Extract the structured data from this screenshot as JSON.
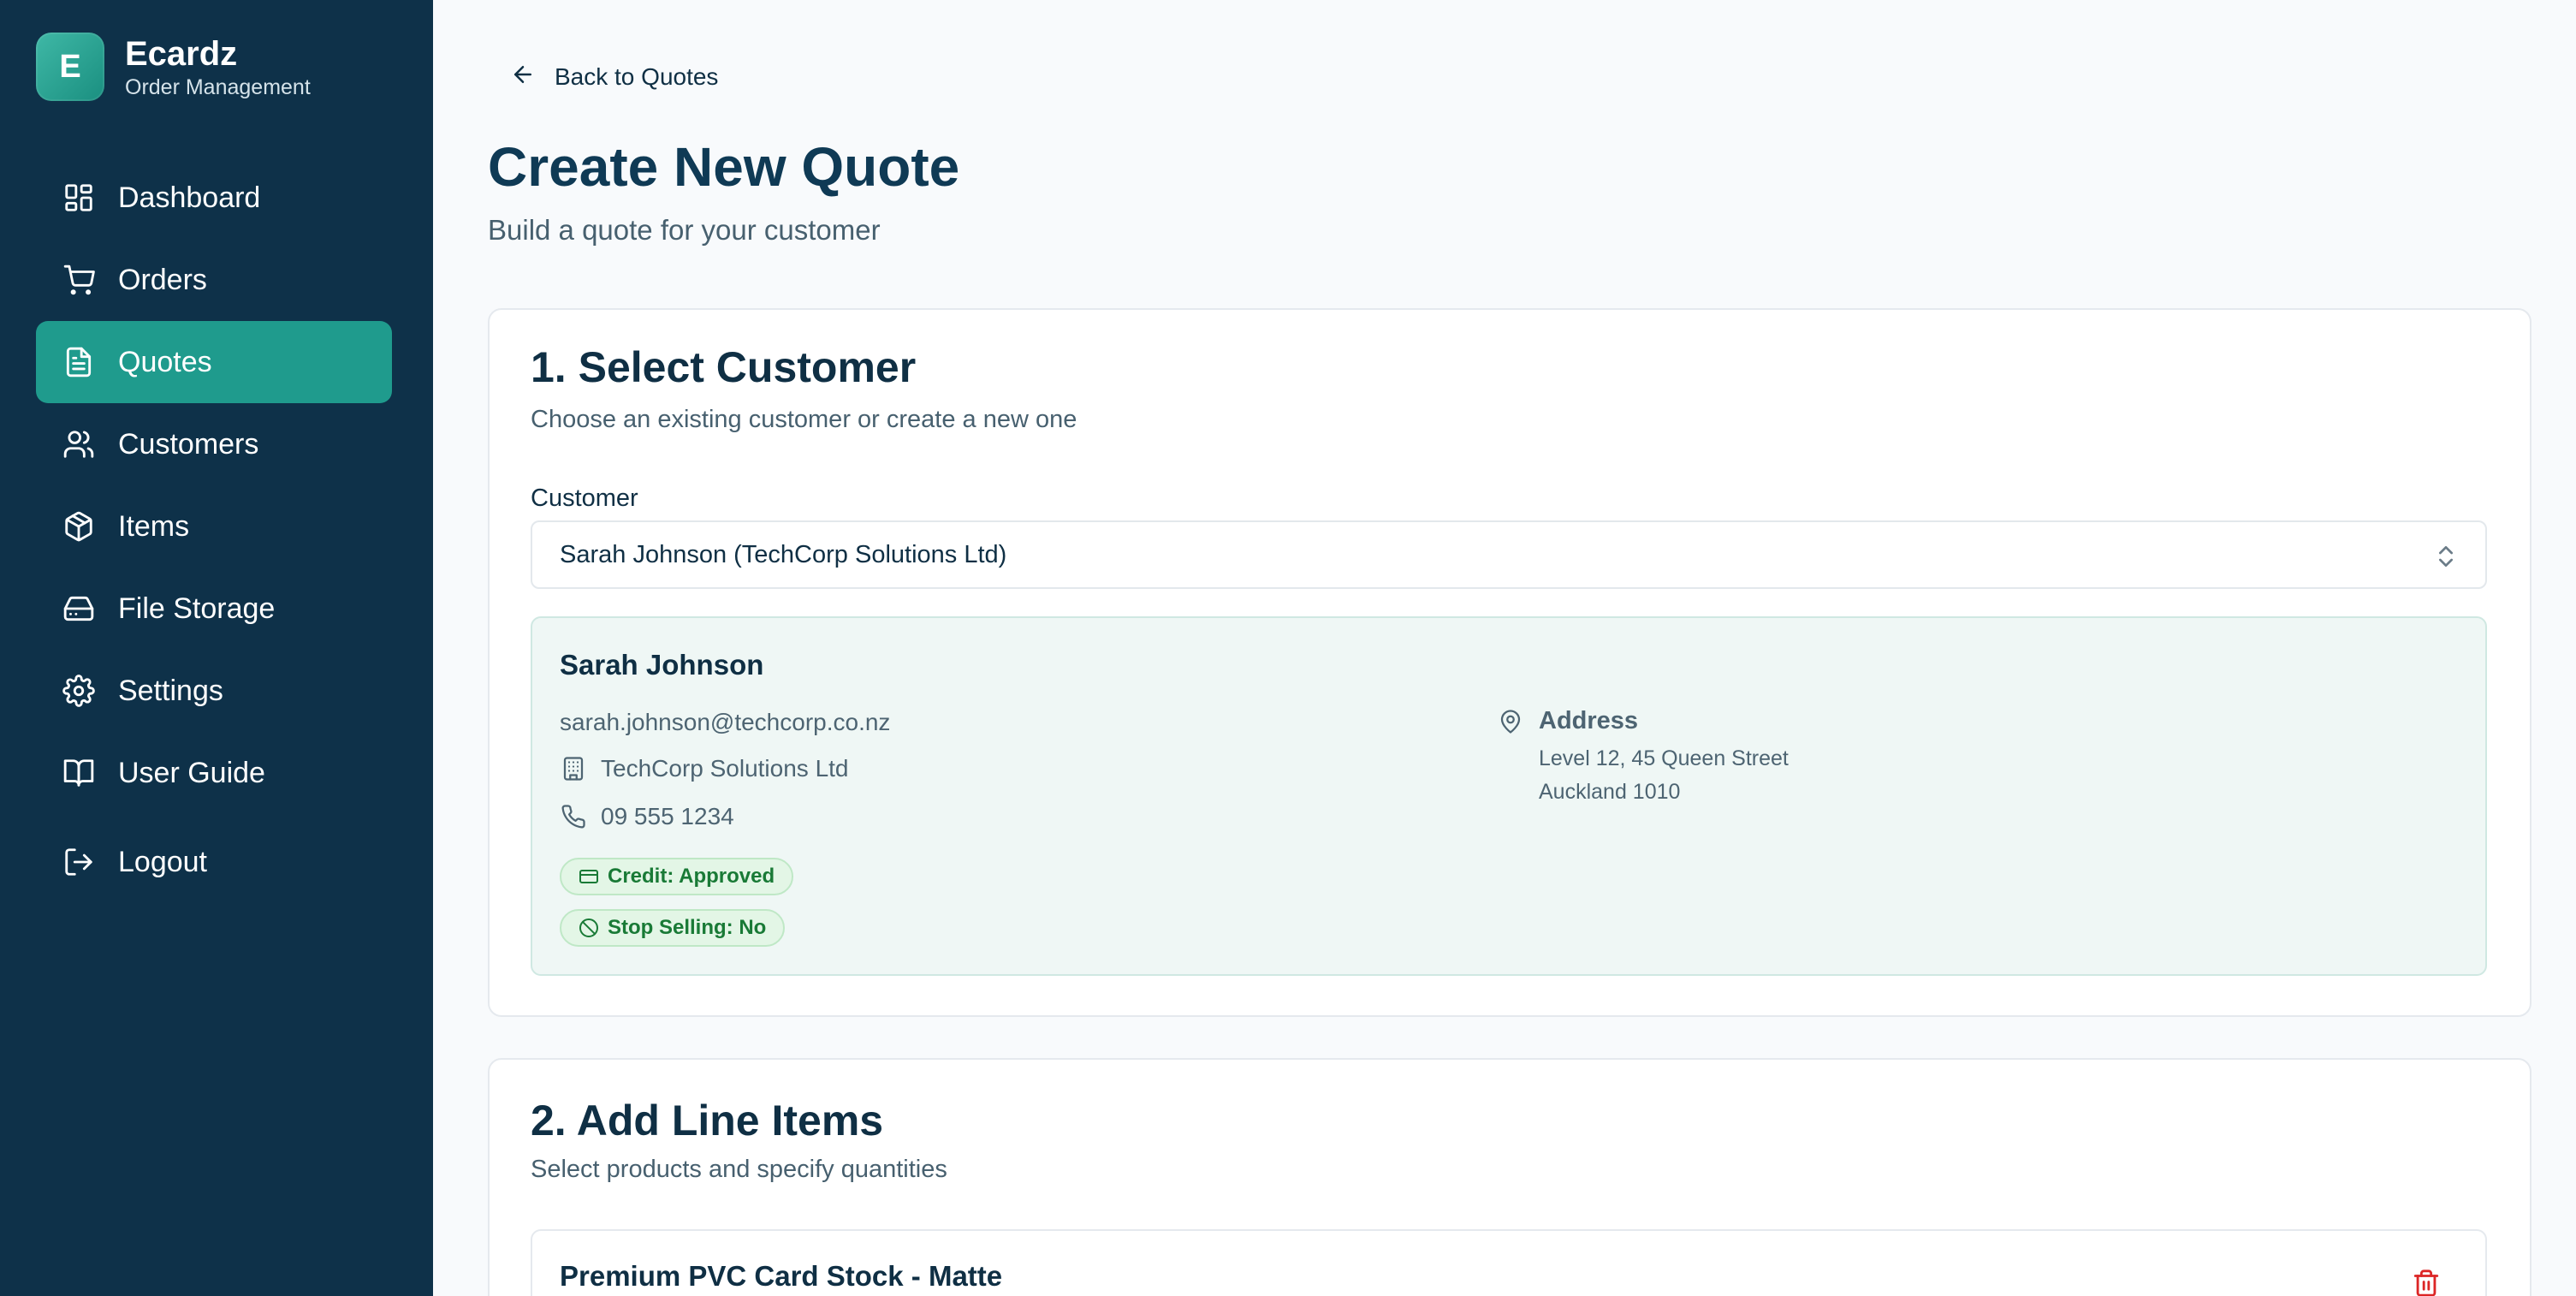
{
  "app": {
    "logo_letter": "E",
    "name": "Ecardz",
    "subtitle": "Order Management"
  },
  "sidebar": {
    "items": [
      {
        "label": "Dashboard",
        "icon": "dashboard-icon"
      },
      {
        "label": "Orders",
        "icon": "cart-icon"
      },
      {
        "label": "Quotes",
        "icon": "document-icon",
        "active": true
      },
      {
        "label": "Customers",
        "icon": "users-icon"
      },
      {
        "label": "Items",
        "icon": "package-icon"
      },
      {
        "label": "File Storage",
        "icon": "hard-drive-icon"
      },
      {
        "label": "Settings",
        "icon": "gear-icon"
      },
      {
        "label": "User Guide",
        "icon": "book-icon"
      },
      {
        "label": "Logout",
        "icon": "logout-icon"
      }
    ]
  },
  "header": {
    "back_label": "Back to Quotes",
    "title": "Create New Quote",
    "subtitle": "Build a quote for your customer"
  },
  "customer_section": {
    "title": "1. Select Customer",
    "subtitle": "Choose an existing customer or create a new one",
    "field_label": "Customer",
    "selected_value": "Sarah Johnson (TechCorp Solutions Ltd)",
    "details": {
      "name": "Sarah Johnson",
      "email": "sarah.johnson@techcorp.co.nz",
      "company": "TechCorp Solutions Ltd",
      "phone": "09 555 1234",
      "credit_badge": "Credit: Approved",
      "stop_selling_badge": "Stop Selling: No",
      "address_label": "Address",
      "address_line1": "Level 12, 45 Queen Street",
      "address_line2": "Auckland 1010"
    }
  },
  "line_items_section": {
    "title": "2. Add Line Items",
    "subtitle": "Select products and specify quantities",
    "items": [
      {
        "name": "Premium PVC Card Stock - Matte"
      }
    ]
  },
  "colors": {
    "sidebar_bg": "#0e3149",
    "active_nav": "#1f9b8d",
    "badge_green": "#197a36",
    "delete_red": "#dc2626"
  }
}
